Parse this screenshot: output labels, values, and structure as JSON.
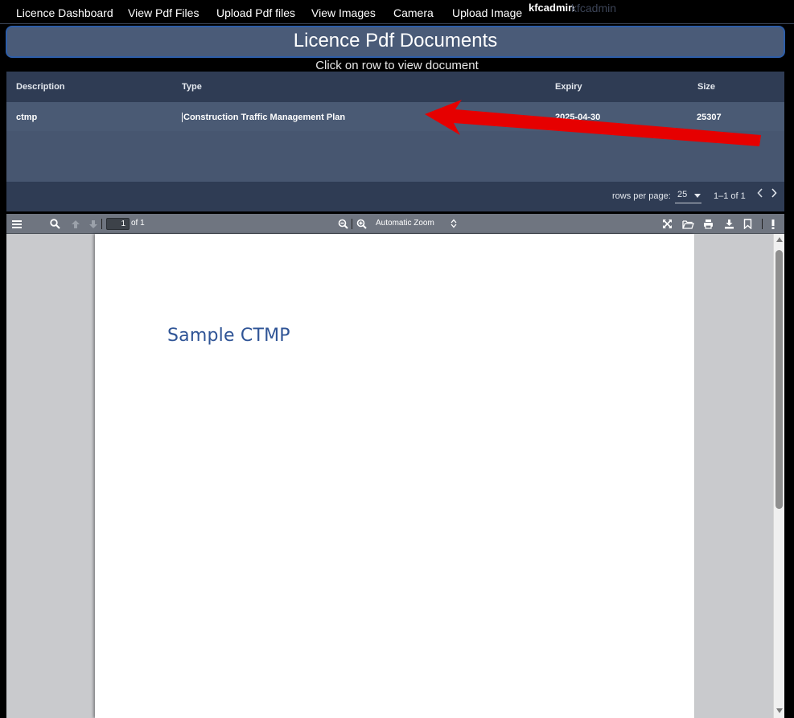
{
  "nav": {
    "items": [
      "Licence Dashboard",
      "View Pdf Files",
      "Upload Pdf files",
      "View Images",
      "Camera",
      "Upload Image"
    ],
    "user_bold": "kfcadmin",
    "user_faded": "kfcadmin"
  },
  "banner": {
    "title": "Licence Pdf Documents",
    "subtitle": "Click on row to view document"
  },
  "table": {
    "columns": [
      "Description",
      "Type",
      "Expiry",
      "Size"
    ],
    "rows": [
      {
        "description": "ctmp",
        "type": "Construction Traffic Management Plan",
        "expiry": "2025-04-30",
        "size": "25307"
      }
    ],
    "footer": {
      "rows_per_page_label": "rows per page:",
      "rows_per_page_value": "25",
      "range": "1–1 of 1",
      "prev_icon": "chevron-left-icon",
      "next_icon": "chevron-right-icon"
    }
  },
  "annotation": {
    "arrow_color": "#e60000"
  },
  "pdf_viewer": {
    "toolbar": {
      "page_number": "1",
      "page_count_label": "of 1",
      "zoom": "Automatic Zoom",
      "icons": [
        "sidebar-toggle-icon",
        "search-icon",
        "previous-page-icon",
        "next-page-icon",
        "zoom-out-icon",
        "zoom-in-icon",
        "presentation-mode-icon",
        "open-file-icon",
        "print-icon",
        "download-icon",
        "bookmark-icon",
        "tools-icon"
      ]
    },
    "page_text": "Sample CTMP",
    "text_color": "#2f5496"
  }
}
